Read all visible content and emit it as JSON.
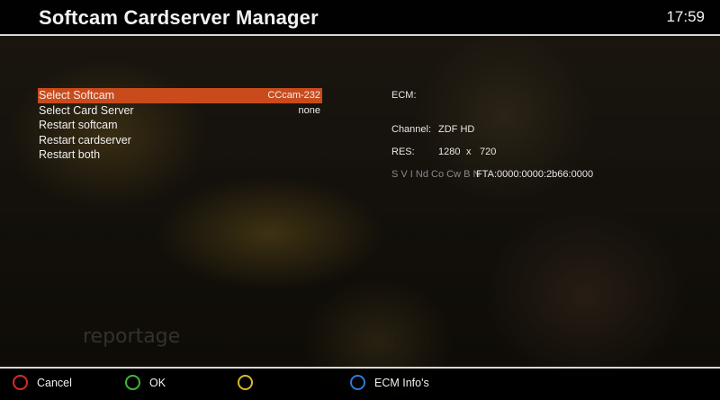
{
  "header": {
    "title": "Softcam Cardserver Manager",
    "clock": "17:59"
  },
  "menu": {
    "items": [
      {
        "label": "Select Softcam",
        "value": "CCcam-232",
        "selected": true
      },
      {
        "label": "Select Card Server",
        "value": "none"
      },
      {
        "label": "Restart softcam",
        "value": ""
      },
      {
        "label": "Restart cardserver",
        "value": ""
      },
      {
        "label": "Restart both",
        "value": ""
      }
    ]
  },
  "info": {
    "ecm_label": "ECM:",
    "channel_label": "Channel:",
    "channel_value": "ZDF HD",
    "res_label": "RES:",
    "res_width": "1280",
    "res_x": "x",
    "res_height": "720",
    "caid_flags": "S V I Nd Co Cw B N",
    "fta_value": "FTA:0000:0000:2b66:0000"
  },
  "background": {
    "watermark": "reportage"
  },
  "footer": {
    "buttons": [
      {
        "label": "Cancel",
        "color": "#d62b2b"
      },
      {
        "label": "OK",
        "color": "#3fb53a"
      },
      {
        "label": "",
        "color": "#d8b82a"
      },
      {
        "label": "ECM Info's",
        "color": "#2a7bd6"
      }
    ]
  },
  "colors": {
    "selection": "#c94b1c",
    "header_bg": "#000000"
  }
}
